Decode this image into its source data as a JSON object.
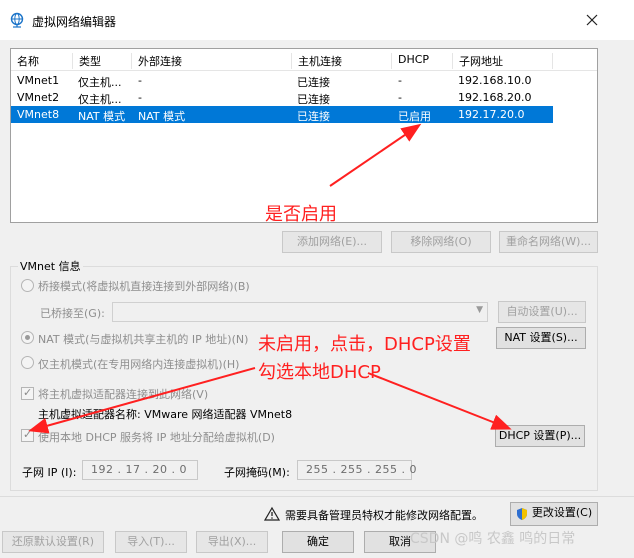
{
  "window": {
    "title": "虚拟网络编辑器"
  },
  "table": {
    "headers": [
      "名称",
      "类型",
      "外部连接",
      "主机连接",
      "DHCP",
      "子网地址"
    ],
    "rows": [
      [
        "VMnet1",
        "仅主机...",
        "-",
        "已连接",
        "-",
        "192.168.10.0"
      ],
      [
        "VMnet2",
        "仅主机...",
        "-",
        "已连接",
        "-",
        "192.168.20.0"
      ],
      [
        "VMnet8",
        "NAT 模式",
        "NAT 模式",
        "已连接",
        "已启用",
        "192.17.20.0"
      ]
    ]
  },
  "net_buttons": {
    "add": "添加网络(E)...",
    "remove": "移除网络(O)",
    "rename": "重命名网络(W)..."
  },
  "vmnet_info": {
    "group_label": "VMnet 信息",
    "bridge_label": "桥接模式(将虚拟机直接连接到外部网络)(B)",
    "bridged_to_label": "已桥接至(G):",
    "auto_settings": "自动设置(U)...",
    "nat_label": "NAT 模式(与虚拟机共享主机的 IP 地址)(N)",
    "nat_settings": "NAT 设置(S)...",
    "hostonly_label": "仅主机模式(在专用网络内连接虚拟机)(H)",
    "connect_adapter_label": "将主机虚拟适配器连接到此网络(V)",
    "adapter_name_label": "主机虚拟适配器名称: VMware 网络适配器 VMnet8",
    "use_dhcp_label": "使用本地 DHCP 服务将 IP 地址分配给虚拟机(D)",
    "dhcp_settings": "DHCP 设置(P)...",
    "subnet_ip_label": "子网 IP (I):",
    "subnet_ip_value": "192 . 17 . 20 . 0",
    "subnet_mask_label": "子网掩码(M):",
    "subnet_mask_value": "255 . 255 . 255 . 0"
  },
  "footer": {
    "admin_notice": "需要具备管理员特权才能修改网络配置。",
    "change_settings": "更改设置(C)",
    "restore_defaults": "还原默认设置(R)",
    "import": "导入(T)...",
    "export": "导出(X)...",
    "ok": "确定",
    "cancel": "取消"
  },
  "annotations": {
    "enabled_question": "是否启用",
    "not_enabled_hint": "未启用，点击，DHCP设置",
    "check_dhcp_hint": "勾选本地DHCP"
  },
  "watermark": "CSDN @鸣 农鑫 鸣的日常",
  "colors": {
    "selection": "#0078d7",
    "annotation": "#ff2020"
  }
}
